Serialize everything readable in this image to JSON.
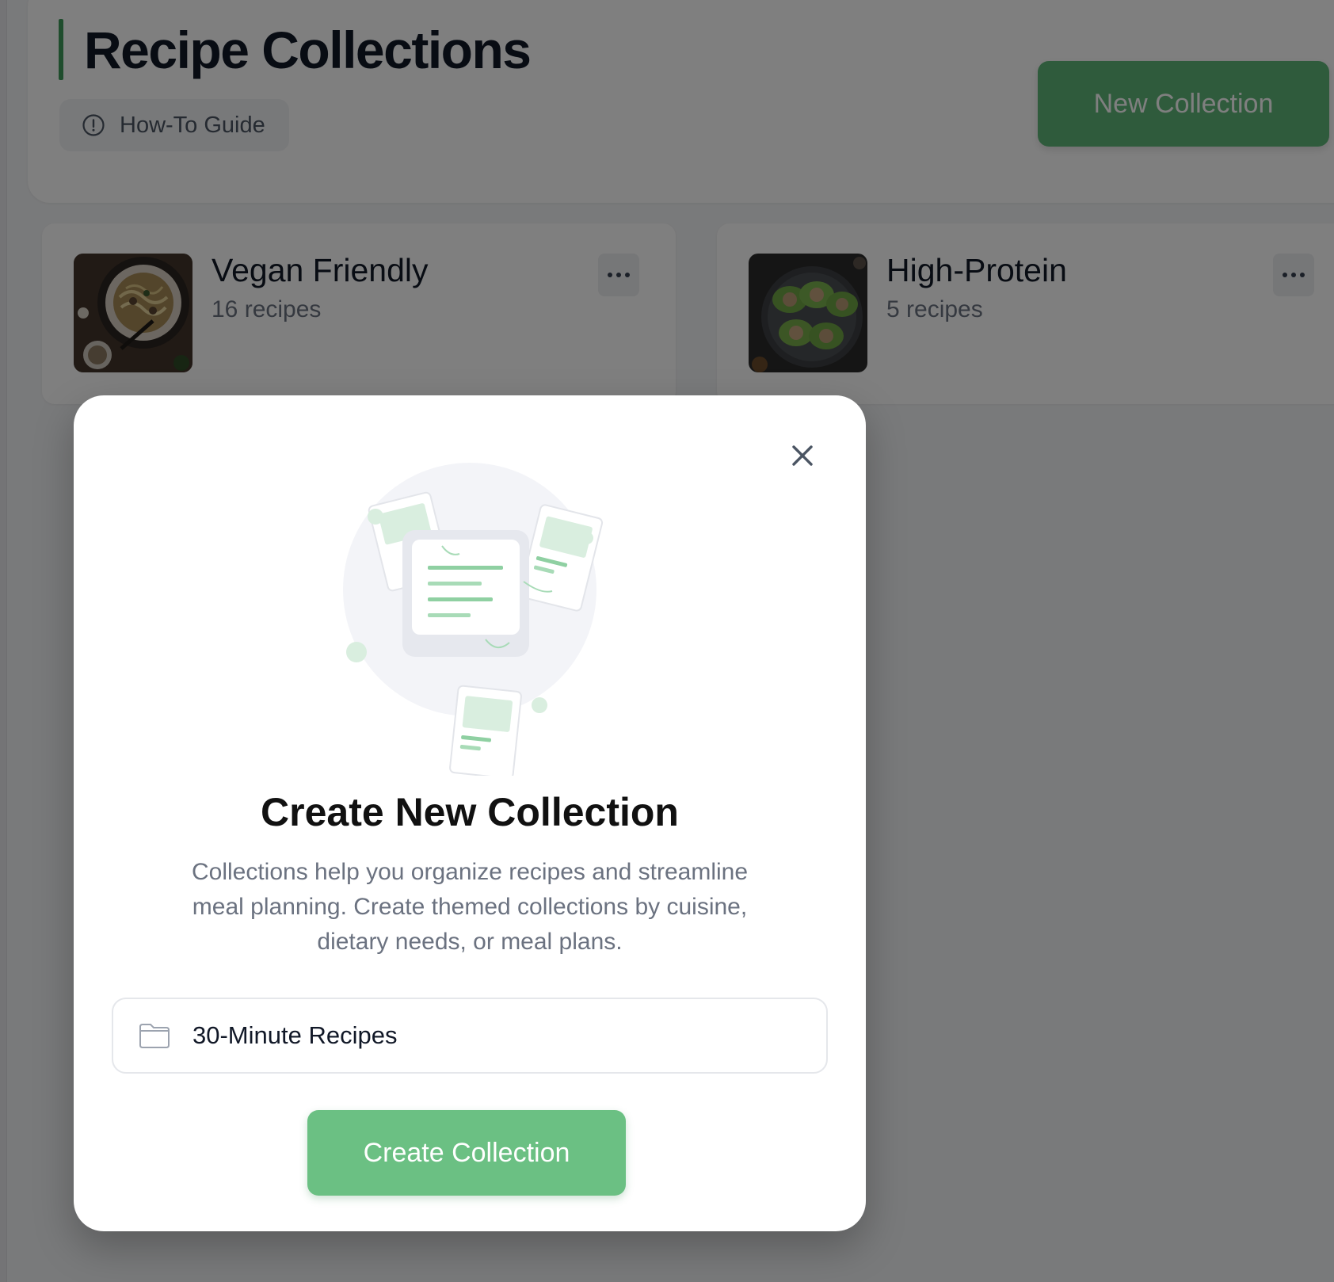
{
  "page": {
    "title": "Recipe Collections",
    "guide_label": "How-To Guide",
    "new_collection_label": "New Collection",
    "accent_color": "#3f9a5a"
  },
  "collections": [
    {
      "name": "Vegan Friendly",
      "count": "16 recipes",
      "thumbnail": "pasta-dish-photo"
    },
    {
      "name": "High-Protein",
      "count": "5 recipes",
      "thumbnail": "lettuce-wraps-photo"
    }
  ],
  "modal": {
    "title": "Create New Collection",
    "description": "Collections help you organize recipes and streamline meal planning. Create themed collections by cuisine, dietary needs, or meal plans.",
    "input_value": "30-Minute Recipes",
    "input_icon": "folder-icon",
    "submit_label": "Create Collection",
    "close_icon": "close-icon",
    "button_color": "#6bc083"
  }
}
